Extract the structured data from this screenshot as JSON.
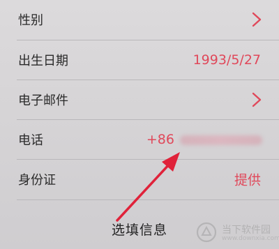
{
  "rows": [
    {
      "label": "性别",
      "value": "",
      "accessory": "chevron-right"
    },
    {
      "label": "出生日期",
      "value": "1993/5/27",
      "accessory": "none"
    },
    {
      "label": "电子邮件",
      "value": "",
      "accessory": "chevron-right"
    },
    {
      "label": "电话",
      "value": "+86",
      "accessory": "blurred-number"
    },
    {
      "label": "身份证",
      "value": "提供",
      "accessory": "none"
    }
  ],
  "footer": {
    "title": "选填信息"
  },
  "annotation": {
    "type": "red-arrow",
    "color": "#e0223a"
  },
  "watermark": {
    "brand": "当下软件园",
    "url": "www.downxia.com"
  },
  "colors": {
    "accent": "#e0485a",
    "text": "#2a2a2a",
    "background": "#d8d6d8"
  }
}
